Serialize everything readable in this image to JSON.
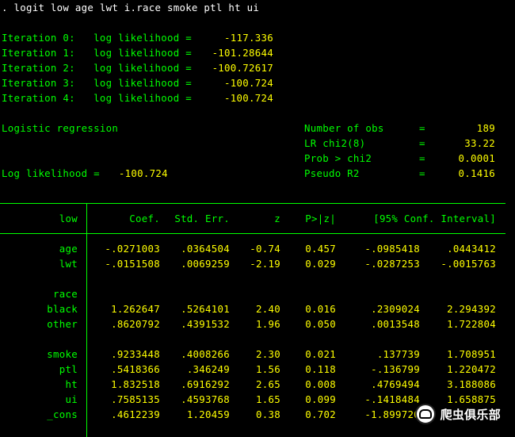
{
  "command": ". logit low age lwt i.race smoke ptl ht ui",
  "iterations": [
    {
      "label": "Iteration 0:",
      "text": "log likelihood =",
      "value": "-117.336"
    },
    {
      "label": "Iteration 1:",
      "text": "log likelihood =",
      "value": "-101.28644"
    },
    {
      "label": "Iteration 2:",
      "text": "log likelihood =",
      "value": "-100.72617"
    },
    {
      "label": "Iteration 3:",
      "text": "log likelihood =",
      "value": "-100.724"
    },
    {
      "label": "Iteration 4:",
      "text": "log likelihood =",
      "value": "-100.724"
    }
  ],
  "model": {
    "title": "Logistic regression",
    "loglik_label": "Log likelihood =",
    "loglik_value": "-100.724",
    "stats": [
      {
        "label": "Number of obs",
        "value": "189"
      },
      {
        "label": "LR chi2(8)",
        "value": "33.22"
      },
      {
        "label": "Prob > chi2",
        "value": "0.0001"
      },
      {
        "label": "Pseudo R2",
        "value": "0.1416"
      }
    ]
  },
  "table": {
    "headers": {
      "var": "low",
      "coef": "Coef.",
      "se": "Std. Err.",
      "z": "z",
      "p": "P>|z|",
      "ci": "[95% Conf. Interval]"
    },
    "rows": [
      {
        "var": "age",
        "coef": "-.0271003",
        "se": ".0364504",
        "z": "-0.74",
        "p": "0.457",
        "lo": "-.0985418",
        "hi": ".0443412"
      },
      {
        "var": "lwt",
        "coef": "-.0151508",
        "se": ".0069259",
        "z": "-2.19",
        "p": "0.029",
        "lo": "-.0287253",
        "hi": "-.0015763"
      },
      {
        "var": "race"
      },
      {
        "var": "black",
        "coef": "1.262647",
        "se": ".5264101",
        "z": "2.40",
        "p": "0.016",
        "lo": ".2309024",
        "hi": "2.294392"
      },
      {
        "var": "other",
        "coef": ".8620792",
        "se": ".4391532",
        "z": "1.96",
        "p": "0.050",
        "lo": ".0013548",
        "hi": "1.722804"
      },
      {
        "var": "smoke",
        "coef": ".9233448",
        "se": ".4008266",
        "z": "2.30",
        "p": "0.021",
        "lo": ".137739",
        "hi": "1.708951"
      },
      {
        "var": "ptl",
        "coef": ".5418366",
        "se": ".346249",
        "z": "1.56",
        "p": "0.118",
        "lo": "-.136799",
        "hi": "1.220472"
      },
      {
        "var": "ht",
        "coef": "1.832518",
        "se": ".6916292",
        "z": "2.65",
        "p": "0.008",
        "lo": ".4769494",
        "hi": "3.188086"
      },
      {
        "var": "ui",
        "coef": ".7585135",
        "se": ".4593768",
        "z": "1.65",
        "p": "0.099",
        "lo": "-.1418484",
        "hi": "1.658875"
      },
      {
        "var": "_cons",
        "coef": ".4612239",
        "se": "1.20459",
        "z": "0.38",
        "p": "0.702",
        "lo": "-1.899720",
        "hi": ""
      }
    ]
  },
  "watermark": "爬虫俱乐部",
  "colors": {
    "background": "#000000",
    "text": "#ffffff",
    "result": "#ffff00",
    "label": "#00ff00"
  }
}
